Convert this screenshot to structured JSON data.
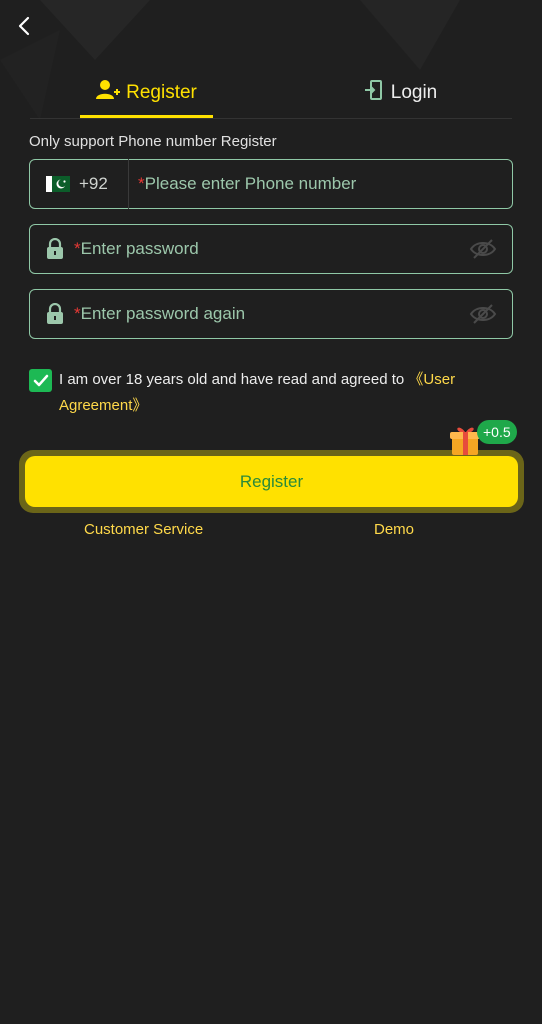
{
  "header": {
    "back_icon": "chevron-left-icon"
  },
  "tabs": [
    {
      "label": "Register",
      "icon": "add-user-icon",
      "active": true
    },
    {
      "label": "Login",
      "icon": "login-door-icon",
      "active": false
    }
  ],
  "form": {
    "note": "Only support Phone number Register",
    "phone": {
      "country_flag": "pakistan-flag",
      "country_code": "+92",
      "required_mark": "*",
      "placeholder": "Please enter Phone number"
    },
    "password": {
      "required_mark": "*",
      "placeholder": "Enter password",
      "visibility_icon": "eye-off-icon"
    },
    "password_confirm": {
      "required_mark": "*",
      "placeholder": "Enter password again",
      "visibility_icon": "eye-off-icon"
    },
    "agreement": {
      "checked": true,
      "text": "I am over 18 years old and have read and agreed to ",
      "link": "《User Agreement》"
    },
    "submit_label": "Register",
    "bonus_badge": "+0.5"
  },
  "footer": {
    "customer_service": "Customer Service",
    "demo": "Demo"
  },
  "colors": {
    "accent": "#ffe100",
    "background": "#1f1f1f",
    "field_border": "#8fc8a6",
    "checkbox": "#1db954",
    "required": "#e53935",
    "link": "#ffd94a"
  }
}
